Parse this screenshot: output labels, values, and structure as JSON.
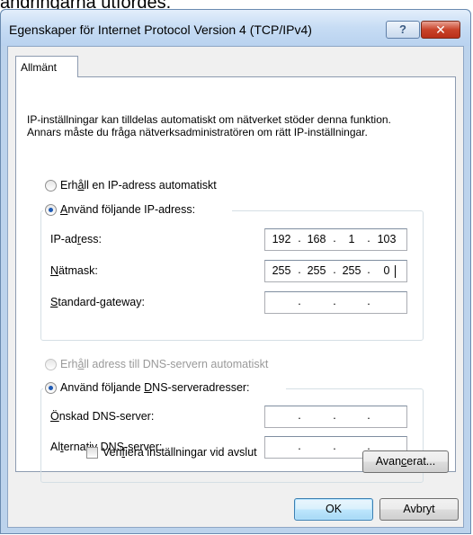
{
  "caption_above": "ändringarna utfördes.",
  "window": {
    "title": "Egenskaper för Internet Protocol Version 4 (TCP/IPv4)",
    "help_glyph": "?",
    "close_glyph": "✕"
  },
  "tab": {
    "label": "Allmänt"
  },
  "description": "IP-inställningar kan tilldelas automatiskt om nätverket stöder denna funktion. Annars måste du fråga nätverksadministratören om rätt IP-inställningar.",
  "ip_section": {
    "auto_radio": {
      "pre": "Erh",
      "ul": "å",
      "post": "ll en IP-adress automatiskt",
      "checked": false
    },
    "manual_radio": {
      "pre": "",
      "ul": "A",
      "post": "nvänd följande IP-adress:",
      "checked": true
    },
    "fields": [
      {
        "pre": "IP-ad",
        "ul": "r",
        "post": "ess:",
        "octets": [
          "192",
          "168",
          "1",
          "103"
        ]
      },
      {
        "pre": "",
        "ul": "N",
        "post": "ätmask:",
        "octets": [
          "255",
          "255",
          "255",
          "0"
        ]
      },
      {
        "pre": "",
        "ul": "S",
        "post": "tandard-gateway:",
        "octets": [
          "",
          "",
          "",
          ""
        ]
      }
    ]
  },
  "dns_section": {
    "auto_radio": {
      "pre": "Erh",
      "ul": "å",
      "post": "ll adress till DNS-servern automatiskt",
      "checked": false,
      "disabled": true
    },
    "manual_radio": {
      "pre": "Använd följande ",
      "ul": "D",
      "post": "NS-serveradresser:",
      "checked": true
    },
    "fields": [
      {
        "pre": "",
        "ul": "Ö",
        "post": "nskad DNS-server:",
        "octets": [
          "",
          "",
          "",
          ""
        ]
      },
      {
        "pre": "Al",
        "ul": "t",
        "post": "ernativ DNS-server:",
        "octets": [
          "",
          "",
          "",
          ""
        ]
      }
    ]
  },
  "validate_checkbox": {
    "pre": "Veri",
    "ul": "f",
    "post": "iera inställningar vid avslut",
    "checked": false
  },
  "buttons": {
    "advanced": {
      "pre": "Avan",
      "ul": "c",
      "post": "erat..."
    },
    "ok": "OK",
    "cancel": "Avbryt"
  },
  "ip_separator": "."
}
